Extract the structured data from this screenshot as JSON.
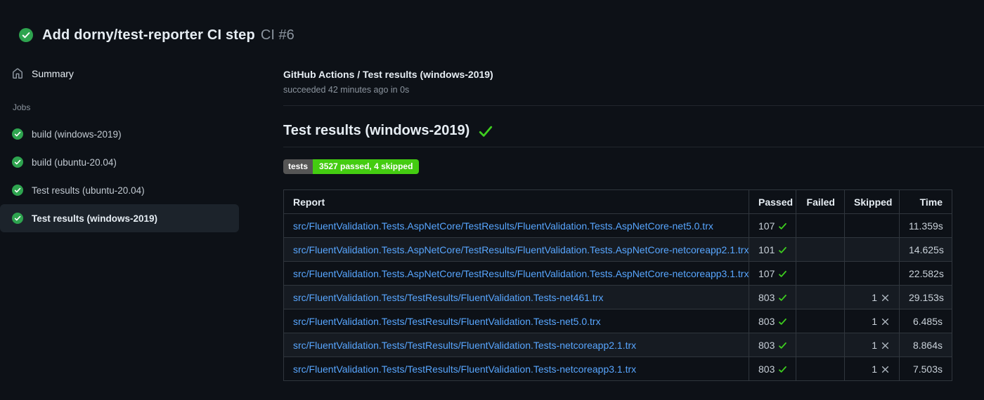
{
  "colors": {
    "page_bg": "#0d1117",
    "text_primary": "#e6edf3",
    "text_secondary": "#8b949e",
    "link": "#58a6ff",
    "border": "#30363d",
    "divider": "#21262d",
    "row_alt_bg": "#161b22",
    "selected_bg": "#1c232b",
    "success_green": "#2ea44f",
    "check_green": "#3ecf1f",
    "badge_green": "#44cc11",
    "badge_gray": "#555555",
    "x_gray": "#afb8c1"
  },
  "icons": {
    "run_status": "check-circle-icon",
    "summary": "home-icon",
    "job_status": "check-circle-icon",
    "section_status": "check-icon",
    "passed_cell": "check-icon",
    "skipped_cell": "x-icon"
  },
  "header": {
    "title": "Add dorny/test-reporter CI step",
    "run_label": "CI #6"
  },
  "sidebar": {
    "summary": "Summary",
    "jobs_heading": "Jobs",
    "jobs": [
      {
        "label": "build (windows-2019)",
        "selected": false
      },
      {
        "label": "build (ubuntu-20.04)",
        "selected": false
      },
      {
        "label": "Test results (ubuntu-20.04)",
        "selected": false
      },
      {
        "label": "Test results (windows-2019)",
        "selected": true
      }
    ]
  },
  "main": {
    "check_name": "GitHub Actions / Test results (windows-2019)",
    "check_status_line": "succeeded 42 minutes ago in 0s",
    "section_title": "Test results (windows-2019)",
    "badge": {
      "label": "tests",
      "value": "3527 passed, 4 skipped"
    },
    "table": {
      "columns": [
        "Report",
        "Passed",
        "Failed",
        "Skipped",
        "Time"
      ],
      "rows": [
        {
          "report": "src/FluentValidation.Tests.AspNetCore/TestResults/FluentValidation.Tests.AspNetCore-net5.0.trx",
          "passed": "107",
          "failed": "",
          "skipped": "",
          "time": "11.359s"
        },
        {
          "report": "src/FluentValidation.Tests.AspNetCore/TestResults/FluentValidation.Tests.AspNetCore-netcoreapp2.1.trx",
          "passed": "101",
          "failed": "",
          "skipped": "",
          "time": "14.625s"
        },
        {
          "report": "src/FluentValidation.Tests.AspNetCore/TestResults/FluentValidation.Tests.AspNetCore-netcoreapp3.1.trx",
          "passed": "107",
          "failed": "",
          "skipped": "",
          "time": "22.582s"
        },
        {
          "report": "src/FluentValidation.Tests/TestResults/FluentValidation.Tests-net461.trx",
          "passed": "803",
          "failed": "",
          "skipped": "1",
          "time": "29.153s"
        },
        {
          "report": "src/FluentValidation.Tests/TestResults/FluentValidation.Tests-net5.0.trx",
          "passed": "803",
          "failed": "",
          "skipped": "1",
          "time": "6.485s"
        },
        {
          "report": "src/FluentValidation.Tests/TestResults/FluentValidation.Tests-netcoreapp2.1.trx",
          "passed": "803",
          "failed": "",
          "skipped": "1",
          "time": "8.864s"
        },
        {
          "report": "src/FluentValidation.Tests/TestResults/FluentValidation.Tests-netcoreapp3.1.trx",
          "passed": "803",
          "failed": "",
          "skipped": "1",
          "time": "7.503s"
        }
      ]
    }
  }
}
